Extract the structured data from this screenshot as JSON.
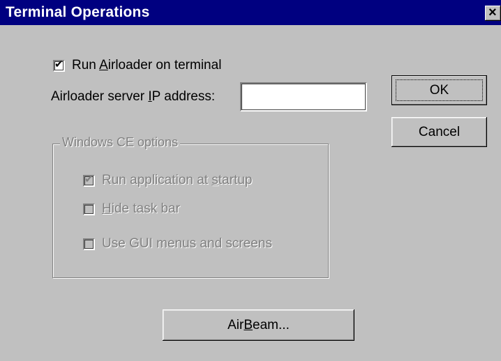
{
  "window": {
    "title": "Terminal Operations",
    "close_glyph": "×"
  },
  "options": {
    "run_airloader": {
      "label_pre": "Run ",
      "label_accel": "A",
      "label_post": "irloader on terminal",
      "checked": true
    },
    "ip_address": {
      "label_pre": "Airloader server ",
      "label_accel": "I",
      "label_post": "P address:",
      "value": ""
    }
  },
  "wince_group": {
    "legend": "Windows CE options",
    "run_at_startup": {
      "label_pre": "Run application at ",
      "label_accel": "s",
      "label_post": "tartup",
      "checked": true,
      "disabled": true
    },
    "hide_task_bar": {
      "label_pre": "",
      "label_accel": "H",
      "label_post": "ide task bar",
      "checked": false,
      "disabled": true
    },
    "use_gui": {
      "label_pre": "Use GUI menus and screens",
      "label_accel": "",
      "label_post": "",
      "checked": false,
      "disabled": true
    }
  },
  "buttons": {
    "ok": "OK",
    "cancel": "Cancel",
    "airbeam_pre": "Air",
    "airbeam_accel": "B",
    "airbeam_post": "eam..."
  },
  "check_glyph": "✔"
}
